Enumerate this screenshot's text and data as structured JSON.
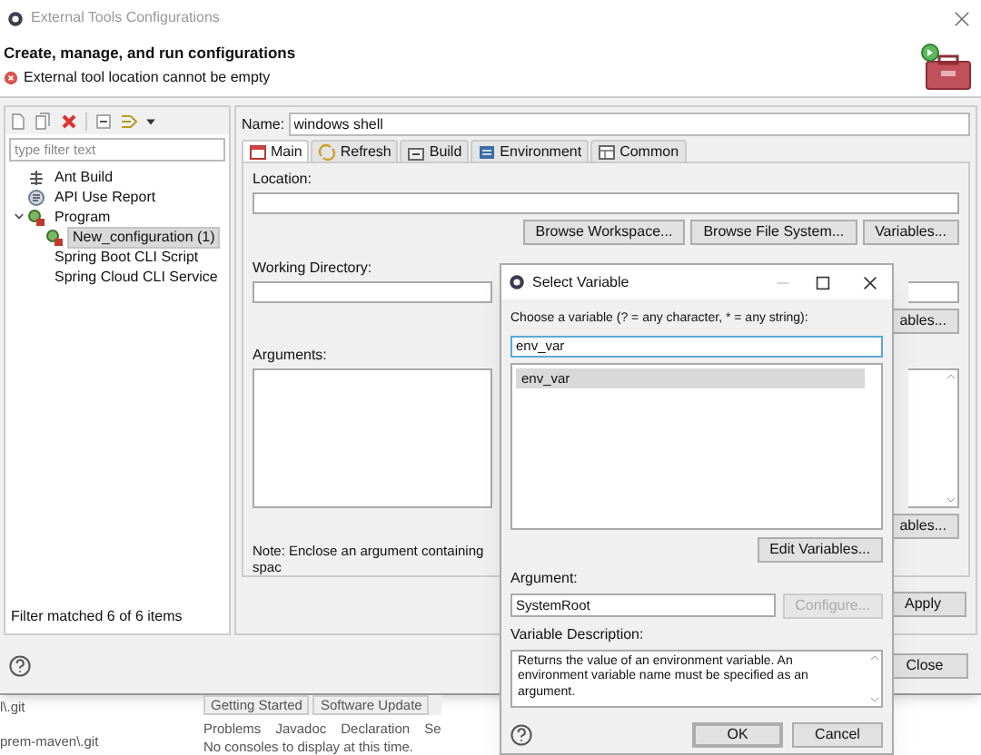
{
  "window": {
    "title": "External Tools Configurations"
  },
  "header": {
    "title": "Create, manage, and run configurations",
    "error": "External tool location cannot be empty"
  },
  "sidebar": {
    "filter": {
      "placeholder": "type filter text"
    },
    "tree": [
      {
        "label": "Ant Build",
        "kind": "ant",
        "selected": false
      },
      {
        "label": "API Use Report",
        "kind": "report",
        "selected": false
      },
      {
        "label": "Program",
        "kind": "program",
        "selected": false,
        "expanded": true,
        "children": [
          {
            "label": "New_configuration (1)",
            "kind": "config",
            "selected": true
          }
        ]
      },
      {
        "label": "Spring Boot CLI Script",
        "kind": "plain",
        "selected": false
      },
      {
        "label": "Spring Cloud CLI Service",
        "kind": "plain",
        "selected": false
      }
    ],
    "status": "Filter matched 6 of 6 items"
  },
  "editor": {
    "name_label": "Name:",
    "name_value": "windows shell",
    "tabs": [
      {
        "label": "Main",
        "kind": "main",
        "selected": true
      },
      {
        "label": "Refresh",
        "kind": "refresh",
        "selected": false
      },
      {
        "label": "Build",
        "kind": "build",
        "selected": false
      },
      {
        "label": "Environment",
        "kind": "environment",
        "selected": false
      },
      {
        "label": "Common",
        "kind": "common",
        "selected": false
      }
    ],
    "location_label": "Location:",
    "location_buttons": [
      "Browse Workspace...",
      "Browse File System...",
      "Variables..."
    ],
    "working_directory_label": "Working Directory:",
    "working_directory_button": "ables...",
    "arguments_label": "Arguments:",
    "arguments_button": "ables...",
    "note": "Note: Enclose an argument containing spac",
    "apply": "Apply"
  },
  "footer": {
    "close": "Close"
  },
  "select_variable": {
    "title": "Select Variable",
    "prompt": "Choose a variable (? = any character, * = any string):",
    "filter_value": "env_var",
    "variables": [
      {
        "label": "env_var",
        "selected": true
      }
    ],
    "edit_button": "Edit Variables...",
    "argument_label": "Argument:",
    "argument_value": "SystemRoot",
    "configure_button": {
      "label": "Configure...",
      "disabled": true
    },
    "description_label": "Variable Description:",
    "description": "Returns the value of an environment variable. An environment variable name must be specified as an argument.",
    "buttons": [
      {
        "label": "OK",
        "default": true
      },
      {
        "label": "Cancel",
        "default": false
      }
    ]
  },
  "background": {
    "projects": [
      "l\\.git",
      "prem-maven\\.git"
    ],
    "editor_tabs": [
      "Getting Started",
      "Software Update"
    ],
    "view_tabs": [
      "Problems",
      "Javadoc",
      "Declaration",
      "Se"
    ],
    "console_message": "No consoles to display at this time."
  }
}
